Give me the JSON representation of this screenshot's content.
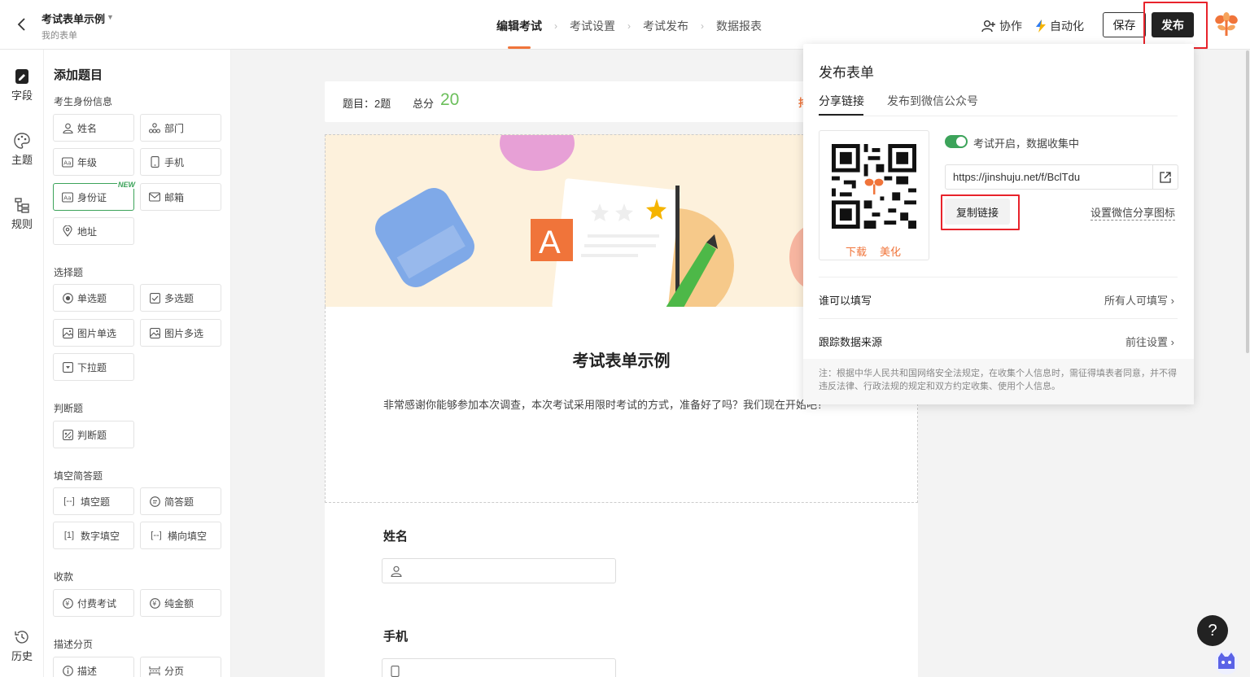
{
  "header": {
    "doc_title": "考试表单示例",
    "doc_subtitle": "我的表单",
    "steps": [
      "编辑考试",
      "考试设置",
      "考试发布",
      "数据报表"
    ],
    "collab": "协作",
    "automation": "自动化",
    "save": "保存",
    "publish": "发布"
  },
  "leftnav": {
    "fields": "字段",
    "theme": "主题",
    "rules": "规则",
    "history": "历史"
  },
  "field_panel": {
    "title": "添加题目",
    "sections": {
      "identity": "考生身份信息",
      "choice": "选择题",
      "judge": "判断题",
      "fill": "填空简答题",
      "payment": "收款",
      "desc": "描述分页"
    },
    "new_tag": "NEW",
    "items": {
      "name": "姓名",
      "dept": "部门",
      "grade": "年级",
      "phone": "手机",
      "idcard": "身份证",
      "email": "邮箱",
      "address": "地址",
      "single": "单选题",
      "multi": "多选题",
      "img_single": "图片单选",
      "img_multi": "图片多选",
      "dropdown": "下拉题",
      "judge": "判断题",
      "blank": "填空题",
      "short": "简答题",
      "num_blank": "数字填空",
      "h_blank": "横向填空",
      "paid_exam": "付费考试",
      "pure_amount": "纯金额",
      "describe": "描述",
      "page": "分页"
    }
  },
  "summary": {
    "questions": "题目：2题",
    "score_label": "总分",
    "score": "20",
    "tab_cut": "排"
  },
  "form": {
    "title": "考试表单示例",
    "description": "非常感谢你能够参加本次调查，本次考试采用限时考试的方式，准备好了吗？我们现在开始吧！",
    "q1": "姓名",
    "q2": "手机"
  },
  "publish_popup": {
    "title": "发布表单",
    "tabs": [
      "分享链接",
      "发布到微信公众号"
    ],
    "download": "下载",
    "beautify": "美化",
    "status": "考试开启，数据收集中",
    "url": "https://jinshuju.net/f/BclTdu",
    "copy": "复制链接",
    "wechat_icon": "设置微信分享图标",
    "rows": [
      {
        "label": "谁可以填写",
        "value": "所有人可填写"
      },
      {
        "label": "跟踪数据来源",
        "value": "前往设置"
      }
    ],
    "note": "注：根据中华人民共和国网络安全法规定，在收集个人信息时，需征得填表者同意，并不得违反法律、行政法规的规定和双方约定收集、使用个人信息。"
  },
  "colors": {
    "accent": "#f0743a",
    "green": "#3ca35a",
    "highlight": "#e8232b"
  }
}
